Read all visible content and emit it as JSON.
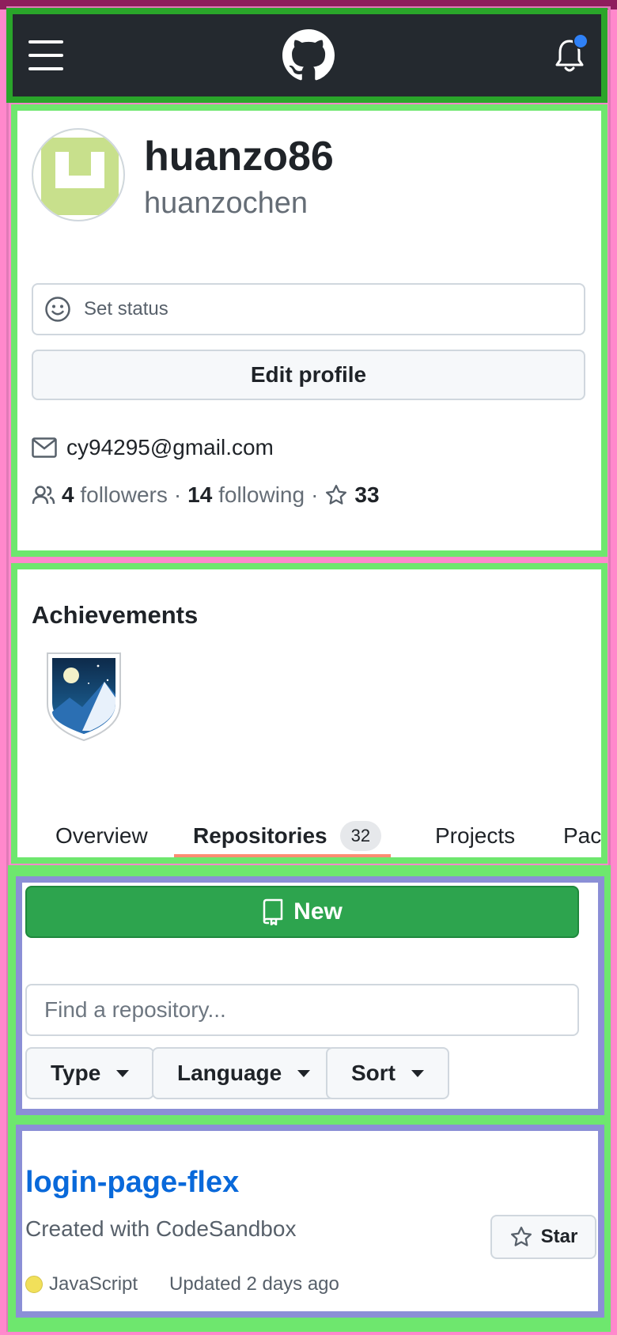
{
  "header": {
    "menu_icon": "hamburger-menu-icon",
    "logo_icon": "github-octocat-logo",
    "notification_icon": "bell-icon",
    "has_unread": true
  },
  "profile": {
    "username": "huanzo86",
    "fullname": "huanzochen",
    "status_label": "Set status",
    "edit_label": "Edit profile",
    "email": "cy94295@gmail.com",
    "followers_count": "4",
    "followers_label": "followers",
    "following_count": "14",
    "following_label": "following",
    "separator": "·",
    "stars_count": "33"
  },
  "achievements": {
    "title": "Achievements"
  },
  "tabs": [
    {
      "label": "Overview"
    },
    {
      "label": "Repositories",
      "count": "32"
    },
    {
      "label": "Projects"
    },
    {
      "label": "Pack"
    }
  ],
  "repo_controls": {
    "new_label": "New",
    "search_placeholder": "Find a repository...",
    "filters": [
      "Type",
      "Language",
      "Sort"
    ]
  },
  "repositories": [
    {
      "name": "login-page-flex",
      "description": "Created with CodeSandbox",
      "star_label": "Star",
      "language": "JavaScript",
      "language_color": "#f1e05a",
      "updated": "Updated 2 days ago"
    }
  ],
  "colors": {
    "header_bg": "#24292f",
    "primary_green": "#2da44e",
    "link_blue": "#0969da",
    "tab_underline": "#fd8c73"
  }
}
